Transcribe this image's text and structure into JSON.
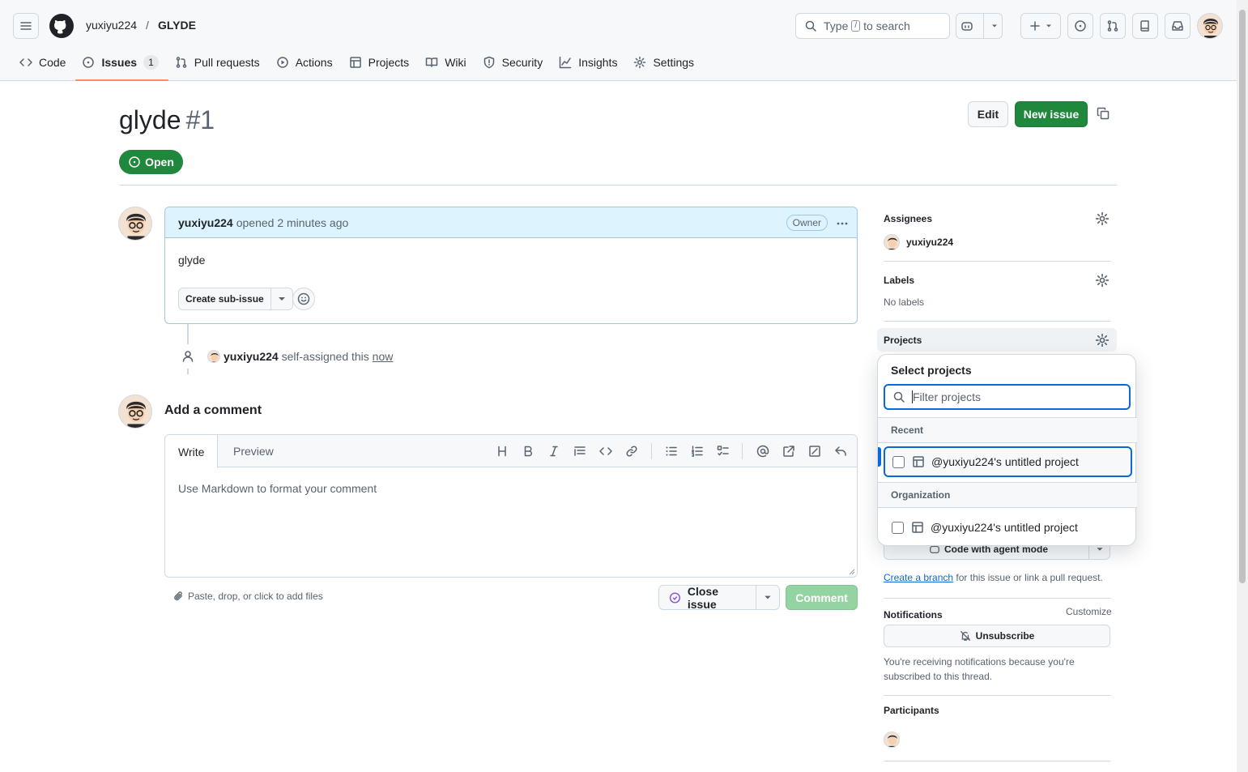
{
  "header": {
    "owner": "yuxiyu224",
    "separator": "/",
    "repo": "GLYDE",
    "search_prefix": "Type",
    "search_key": "/",
    "search_suffix": "to search"
  },
  "tabs": [
    {
      "label": "Code"
    },
    {
      "label": "Issues",
      "count": "1"
    },
    {
      "label": "Pull requests"
    },
    {
      "label": "Actions"
    },
    {
      "label": "Projects"
    },
    {
      "label": "Wiki"
    },
    {
      "label": "Security"
    },
    {
      "label": "Insights"
    },
    {
      "label": "Settings"
    }
  ],
  "issue": {
    "title": "glyde",
    "number": "#1",
    "edit_label": "Edit",
    "new_issue_label": "New issue",
    "state": "Open"
  },
  "comment": {
    "author": "yuxiyu224",
    "action": "opened 2 minutes ago",
    "badge": "Owner",
    "body": "glyde",
    "create_sub_issue": "Create sub-issue"
  },
  "event": {
    "user": "yuxiyu224",
    "text": "self-assigned this",
    "time": "now"
  },
  "add_comment": {
    "heading": "Add a comment",
    "write_tab": "Write",
    "preview_tab": "Preview",
    "placeholder": "Use Markdown to format your comment",
    "attach_text": "Paste, drop, or click to add files",
    "close_issue": "Close issue",
    "comment_button": "Comment"
  },
  "sidebar": {
    "assignees_label": "Assignees",
    "assignee": "yuxiyu224",
    "labels_label": "Labels",
    "labels_value": "No labels",
    "projects_label": "Projects",
    "code_agent": "Code with agent mode",
    "create_branch": "Create a branch",
    "branch_suffix": "for this issue or link a pull request.",
    "notifications_label": "Notifications",
    "customize": "Customize",
    "unsubscribe": "Unsubscribe",
    "notif_reason": "You're receiving notifications because you're subscribed to this thread.",
    "participants_label": "Participants"
  },
  "popover": {
    "title": "Select projects",
    "filter_placeholder": "Filter projects",
    "recent_label": "Recent",
    "recent_item": "@yuxiyu224's untitled project",
    "org_label": "Organization",
    "org_item": "@yuxiyu224's untitled project"
  },
  "colors": {
    "accent_green": "#1f883d",
    "link_blue": "#0969da",
    "tab_underline": "#fd8c73"
  }
}
